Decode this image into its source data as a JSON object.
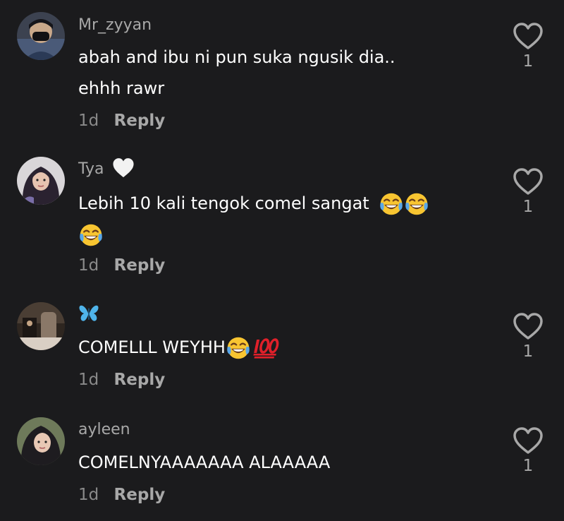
{
  "comments": [
    {
      "username": "Mr_zyyan",
      "text_line1": "abah and ibu ni pun suka ngusik dia..",
      "text_line2": "ehhh rawr",
      "time": "1d",
      "reply_label": "Reply",
      "likes": "1"
    },
    {
      "username": "Tya",
      "username_badge": "white-heart",
      "text": "Lebih 10 kali tengok comel sangat",
      "emojis": [
        "face-with-tears-of-joy",
        "face-with-tears-of-joy",
        "face-with-tears-of-joy"
      ],
      "time": "1d",
      "reply_label": "Reply",
      "likes": "1"
    },
    {
      "username_badge": "blue-butterfly",
      "text": "COMELLL WEYHH",
      "emojis": [
        "face-with-tears-of-joy",
        "hundred-points"
      ],
      "time": "1d",
      "reply_label": "Reply",
      "likes": "1"
    },
    {
      "username": "ayleen",
      "text": "COMELNYAAAAAAA ALAAAAA",
      "time": "1d",
      "reply_label": "Reply",
      "likes": "1"
    }
  ],
  "colors": {
    "background": "#1b1b1d",
    "text_primary": "#ffffff",
    "text_secondary": "#a8a8a8",
    "emoji_yellow": "#f8c531",
    "tear_blue": "#5aa7e8",
    "hundred_red": "#e0202a"
  }
}
